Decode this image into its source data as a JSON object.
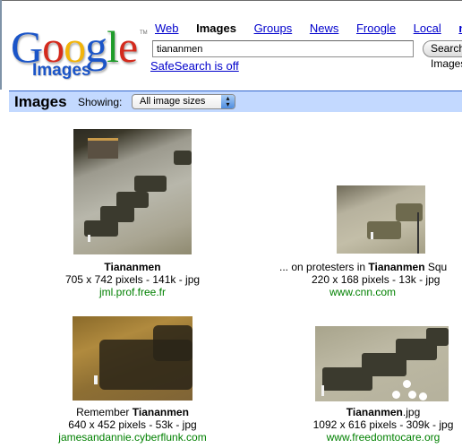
{
  "logo": {
    "letters": [
      "G",
      "o",
      "o",
      "g",
      "l",
      "e"
    ],
    "tm": "TM",
    "subtitle": "Images"
  },
  "nav": {
    "items": [
      {
        "label": "Web",
        "active": false
      },
      {
        "label": "Images",
        "active": true
      },
      {
        "label": "Groups",
        "active": false
      },
      {
        "label": "News",
        "active": false
      },
      {
        "label": "Froogle",
        "active": false
      },
      {
        "label": "Local",
        "active": false
      },
      {
        "label": "more »",
        "active": false
      }
    ]
  },
  "search": {
    "query": "tiananmen",
    "button_label": "Search Images"
  },
  "safesearch_label": "SafeSearch is off",
  "results_bar": {
    "title": "Images",
    "showing_label": "Showing:",
    "size_filter": "All image sizes"
  },
  "results": [
    {
      "title_pre": "",
      "title_bold": "Tiananmen",
      "title_post": "",
      "info": "705 x 742 pixels - 141k - jpg",
      "source": "jml.prof.free.fr"
    },
    {
      "title_pre": "... on protesters in ",
      "title_bold": "Tiananmen",
      "title_post": " Squ",
      "info": "220 x 168 pixels - 13k - jpg",
      "source": "www.cnn.com"
    },
    {
      "title_pre": "Remember ",
      "title_bold": "Tiananmen",
      "title_post": "",
      "info": "640 x 452 pixels - 53k - jpg",
      "source": "jamesandannie.cyberflunk.com"
    },
    {
      "title_pre": "",
      "title_bold": "Tiananmen",
      "title_post": ".jpg",
      "info": "1092 x 616 pixels - 309k - jpg",
      "source": "www.freedomtocare.org"
    }
  ]
}
